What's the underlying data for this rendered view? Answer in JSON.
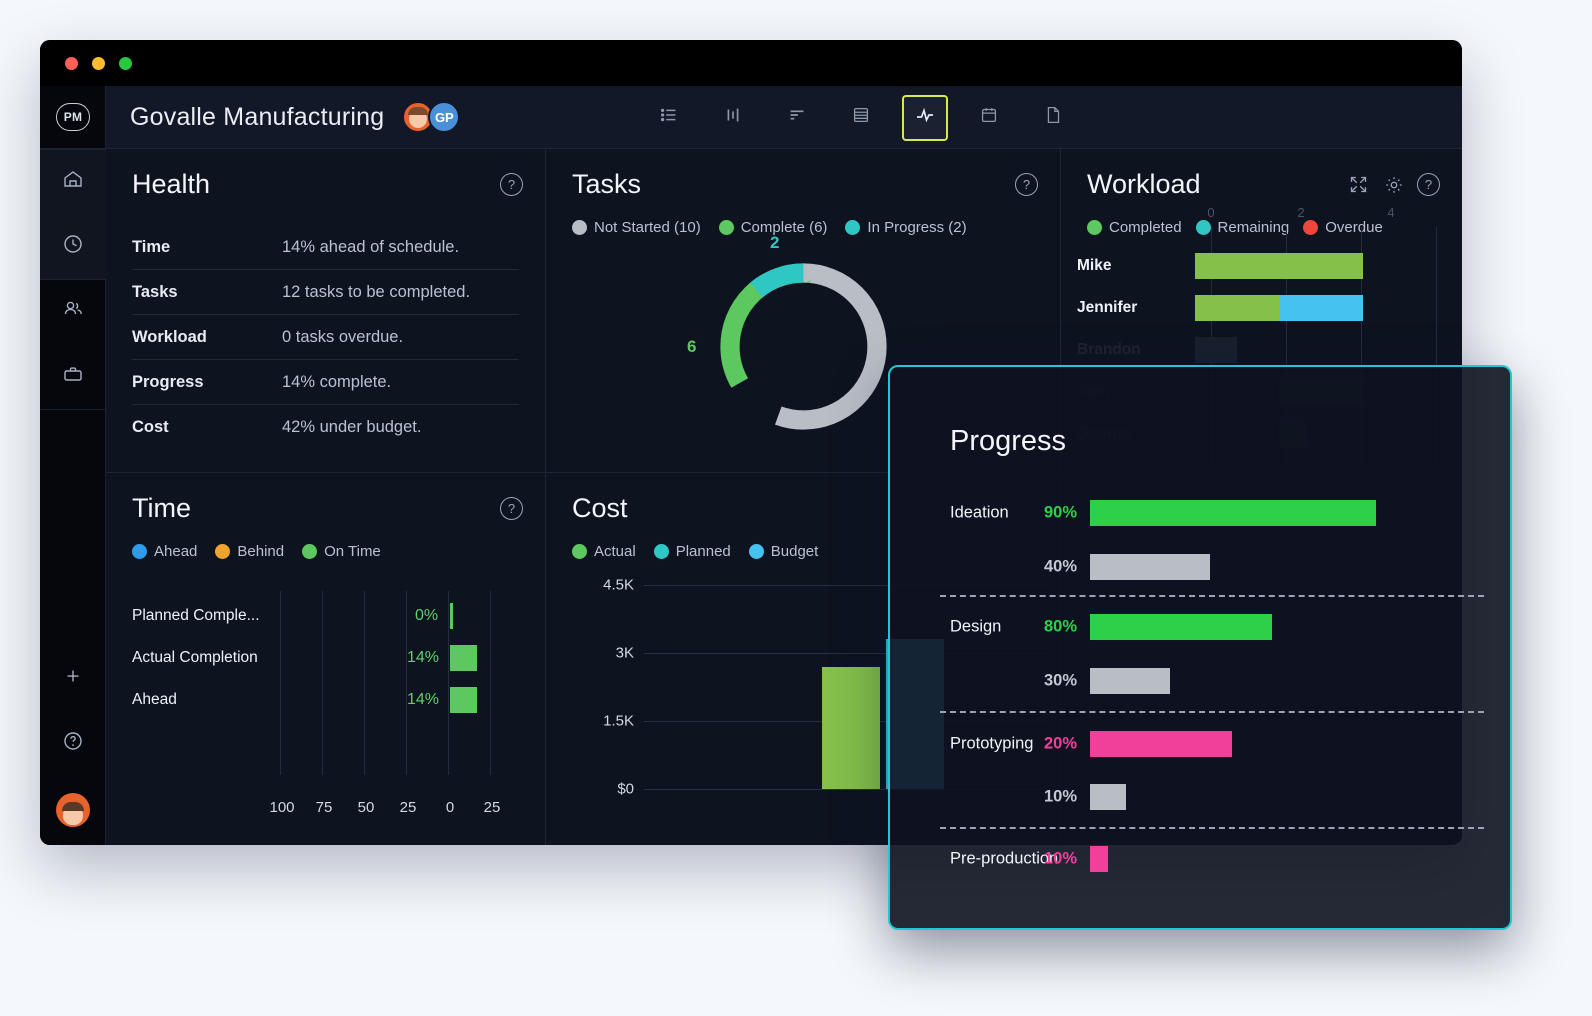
{
  "window": {
    "traffic_lights": [
      "close",
      "minimize",
      "maximize"
    ]
  },
  "sidebar": {
    "logo": "PM",
    "items": [
      {
        "name": "home",
        "icon": "home-icon"
      },
      {
        "name": "recent",
        "icon": "clock-icon"
      },
      {
        "name": "people",
        "icon": "people-icon"
      },
      {
        "name": "portfolio",
        "icon": "briefcase-icon"
      }
    ],
    "bottom": [
      {
        "name": "add",
        "icon": "plus-icon"
      },
      {
        "name": "help",
        "icon": "help-icon"
      }
    ],
    "avatar": "user-avatar"
  },
  "header": {
    "title": "Govalle Manufacturing",
    "avatars": [
      {
        "type": "photo"
      },
      {
        "type": "initials",
        "initials": "GP"
      }
    ],
    "tabs": [
      {
        "name": "list",
        "icon": "list-icon",
        "active": false
      },
      {
        "name": "board",
        "icon": "board-icon",
        "active": false
      },
      {
        "name": "gantt",
        "icon": "gantt-icon",
        "active": false
      },
      {
        "name": "sheet",
        "icon": "sheet-icon",
        "active": false
      },
      {
        "name": "dashboard",
        "icon": "pulse-icon",
        "active": true
      },
      {
        "name": "calendar",
        "icon": "calendar-icon",
        "active": false
      },
      {
        "name": "pages",
        "icon": "file-icon",
        "active": false
      }
    ]
  },
  "health": {
    "title": "Health",
    "help": "?",
    "rows": [
      {
        "key": "Time",
        "value": "14% ahead of schedule."
      },
      {
        "key": "Tasks",
        "value": "12 tasks to be completed."
      },
      {
        "key": "Workload",
        "value": "0 tasks overdue."
      },
      {
        "key": "Progress",
        "value": "14% complete."
      },
      {
        "key": "Cost",
        "value": "42% under budget."
      }
    ]
  },
  "tasks": {
    "title": "Tasks",
    "help": "?",
    "chart_data": {
      "type": "pie",
      "title": "Tasks",
      "categories": [
        "Not Started",
        "Complete",
        "In Progress"
      ],
      "values": [
        10,
        6,
        2
      ],
      "colors": [
        "#b9bec6",
        "#5cc85f",
        "#2fc7c4"
      ],
      "legend": [
        "Not Started (10)",
        "Complete (6)",
        "In Progress (2)"
      ],
      "legend_position": "top",
      "labels_shown": [
        "2",
        "6"
      ],
      "label_colors": [
        "#2fc7c4",
        "#5cc85f"
      ]
    }
  },
  "workload": {
    "title": "Workload",
    "icons": [
      "expand-icon",
      "gear-icon",
      "help-icon"
    ],
    "legend": [
      {
        "label": "Completed",
        "color": "#5cc85f"
      },
      {
        "label": "Remaining",
        "color": "#2fc7c4"
      },
      {
        "label": "Overdue",
        "color": "#f0453d"
      }
    ],
    "chart_data": {
      "type": "bar",
      "orientation": "horizontal",
      "title": "Workload",
      "categories": [
        "Mike",
        "Jennifer",
        "Brandon",
        "Sam",
        "George"
      ],
      "xticks": [
        "0",
        "2",
        "4"
      ],
      "xlim": [
        0,
        5
      ],
      "series": [
        {
          "name": "Completed",
          "values": [
            4,
            2,
            1,
            0,
            0
          ],
          "color": "#84c04a"
        },
        {
          "name": "Remaining",
          "values": [
            0,
            2,
            0,
            2,
            0.6
          ],
          "color": "#46c2f0"
        }
      ]
    }
  },
  "time": {
    "title": "Time",
    "help": "?",
    "legend": [
      {
        "label": "Ahead",
        "color": "#2f9bea"
      },
      {
        "label": "Behind",
        "color": "#f0a32e"
      },
      {
        "label": "On Time",
        "color": "#5cc85f"
      }
    ],
    "chart_data": {
      "type": "bar",
      "orientation": "horizontal",
      "title": "Time",
      "categories": [
        "Planned Comple...",
        "Actual Completion",
        "Ahead"
      ],
      "values": [
        0,
        14,
        14
      ],
      "value_labels": [
        "0%",
        "14%",
        "14%"
      ],
      "xticks": [
        "100",
        "75",
        "50",
        "25",
        "0",
        "25"
      ],
      "bar_color": "#5cc85f"
    }
  },
  "cost": {
    "title": "Cost",
    "legend": [
      {
        "label": "Actual",
        "color": "#5cc85f"
      },
      {
        "label": "Planned",
        "color": "#2fc7c4"
      },
      {
        "label": "Budget",
        "color": "#46c2f0"
      }
    ],
    "chart_data": {
      "type": "bar",
      "title": "Cost",
      "categories": [
        "Actual",
        "Budget"
      ],
      "series": [
        {
          "name": "Actual",
          "values": [
            2700
          ],
          "color": "#84c04a"
        },
        {
          "name": "Budget",
          "values": [
            3300
          ],
          "color": "#46c2f0"
        }
      ],
      "yticks": [
        "$0",
        "1.5K",
        "3K",
        "4.5K"
      ],
      "ylim": [
        0,
        4500
      ]
    }
  },
  "progress": {
    "title": "Progress",
    "chart_data": {
      "type": "bar",
      "orientation": "horizontal",
      "title": "Progress",
      "groups": [
        {
          "name": "Ideation",
          "primary_pct": "90%",
          "primary_value": 90,
          "primary_color": "#2ed04a",
          "secondary_pct": "40%",
          "secondary_value": 40,
          "secondary_color": "#b9bec6"
        },
        {
          "name": "Design",
          "primary_pct": "80%",
          "primary_value": 80,
          "primary_color": "#2ed04a",
          "secondary_pct": "30%",
          "secondary_value": 30,
          "secondary_color": "#b9bec6"
        },
        {
          "name": "Prototyping",
          "primary_pct": "20%",
          "primary_value": 20,
          "primary_color": "#f0409a",
          "secondary_pct": "10%",
          "secondary_value": 10,
          "secondary_color": "#b9bec6"
        },
        {
          "name": "Pre-production",
          "primary_pct": "10%",
          "primary_value": 10,
          "primary_color": "#f0409a",
          "secondary_pct": "",
          "secondary_value": 0,
          "secondary_color": "#b9bec6"
        }
      ]
    }
  }
}
